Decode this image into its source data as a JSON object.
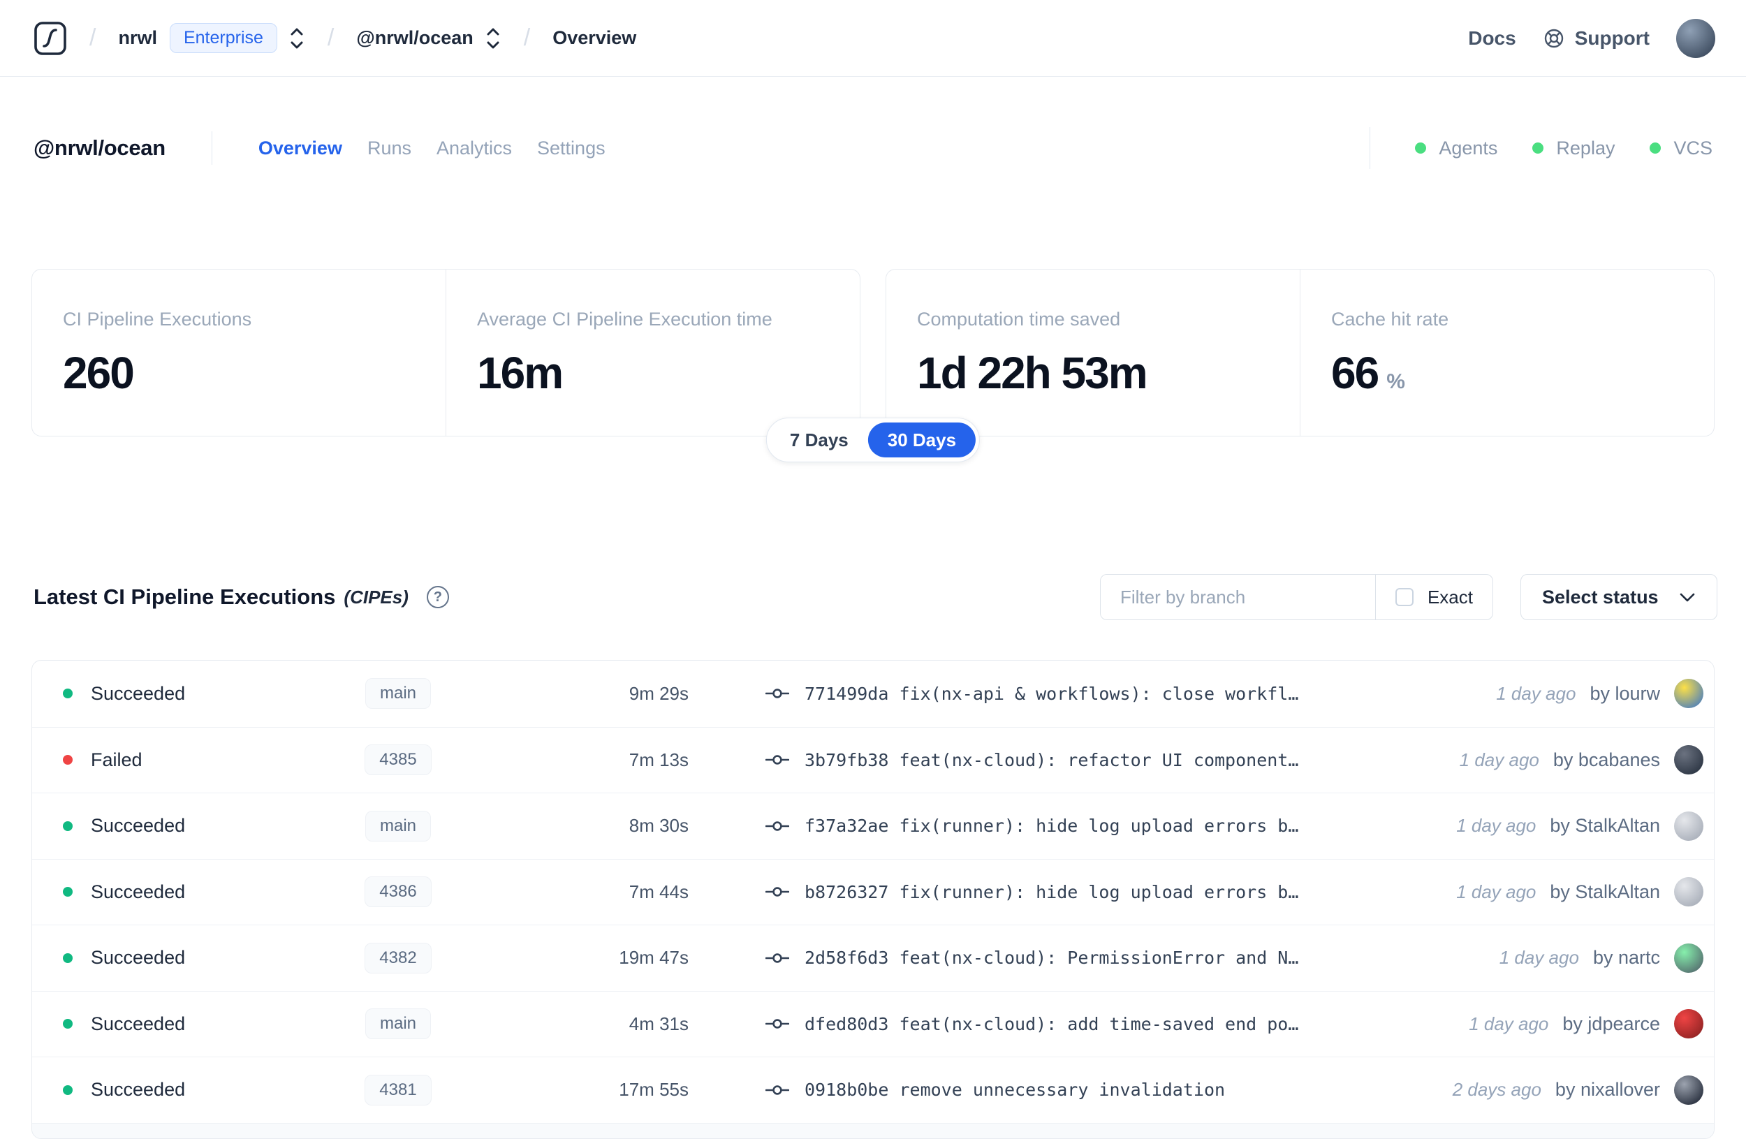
{
  "nav": {
    "separator": "/",
    "breadcrumb": {
      "org": "nrwl",
      "plan_badge": "Enterprise",
      "workspace": "@nrwl/ocean",
      "page": "Overview"
    },
    "links": {
      "docs": "Docs",
      "support": "Support"
    },
    "avatar_colors": [
      "#8fa0b5",
      "#2c3a4d"
    ]
  },
  "workspace_header": {
    "title": "@nrwl/ocean",
    "tabs": [
      {
        "label": "Overview",
        "active": true
      },
      {
        "label": "Runs",
        "active": false
      },
      {
        "label": "Analytics",
        "active": false
      },
      {
        "label": "Settings",
        "active": false
      }
    ],
    "status_indicators": [
      {
        "label": "Agents",
        "color": "#4ade80"
      },
      {
        "label": "Replay",
        "color": "#4ade80"
      },
      {
        "label": "VCS",
        "color": "#4ade80"
      }
    ]
  },
  "stats": {
    "cards": [
      {
        "label": "CI Pipeline Executions",
        "value": "260",
        "unit": ""
      },
      {
        "label": "Average CI Pipeline Execution time",
        "value": "16m",
        "unit": ""
      },
      {
        "label": "Computation time saved",
        "value": "1d 22h 53m",
        "unit": ""
      },
      {
        "label": "Cache hit rate",
        "value": "66",
        "unit": "%"
      }
    ],
    "range_toggle": {
      "options": [
        "7 Days",
        "30 Days"
      ],
      "selected": "30 Days"
    }
  },
  "cipes": {
    "title": "Latest CI Pipeline Executions",
    "title_suffix": "(CIPEs)",
    "help_icon": "?",
    "filter": {
      "placeholder": "Filter by branch",
      "exact_label": "Exact",
      "exact_checked": false
    },
    "status_select": {
      "label": "Select status"
    },
    "rows": [
      {
        "status": "Succeeded",
        "status_color": "#10b981",
        "branch": "main",
        "duration": "9m 29s",
        "commit": "771499da fix(nx-api & workflows): close workfl…",
        "time_ago": "1 day ago",
        "author": "by lourw",
        "avatar_colors": [
          "#fde047",
          "#2f6fd0"
        ]
      },
      {
        "status": "Failed",
        "status_color": "#ef4444",
        "branch": "4385",
        "duration": "7m 13s",
        "commit": "3b79fb38 feat(nx-cloud): refactor UI component…",
        "time_ago": "1 day ago",
        "author": "by bcabanes",
        "avatar_colors": [
          "#6b7280",
          "#1f2937"
        ]
      },
      {
        "status": "Succeeded",
        "status_color": "#10b981",
        "branch": "main",
        "duration": "8m 30s",
        "commit": "f37a32ae fix(runner): hide log upload errors b…",
        "time_ago": "1 day ago",
        "author": "by StalkAltan",
        "avatar_colors": [
          "#e5e7eb",
          "#9ca3af"
        ]
      },
      {
        "status": "Succeeded",
        "status_color": "#10b981",
        "branch": "4386",
        "duration": "7m 44s",
        "commit": "b8726327 fix(runner): hide log upload errors b…",
        "time_ago": "1 day ago",
        "author": "by StalkAltan",
        "avatar_colors": [
          "#e5e7eb",
          "#9ca3af"
        ]
      },
      {
        "status": "Succeeded",
        "status_color": "#10b981",
        "branch": "4382",
        "duration": "19m 47s",
        "commit": "2d58f6d3 feat(nx-cloud): PermissionError and N…",
        "time_ago": "1 day ago",
        "author": "by nartc",
        "avatar_colors": [
          "#86efac",
          "#4b5563"
        ]
      },
      {
        "status": "Succeeded",
        "status_color": "#10b981",
        "branch": "main",
        "duration": "4m 31s",
        "commit": "dfed80d3 feat(nx-cloud): add time-saved end po…",
        "time_ago": "1 day ago",
        "author": "by jdpearce",
        "avatar_colors": [
          "#ef4444",
          "#7f1d1d"
        ]
      },
      {
        "status": "Succeeded",
        "status_color": "#10b981",
        "branch": "4381",
        "duration": "17m 55s",
        "commit": "0918b0be remove unnecessary invalidation",
        "time_ago": "2 days ago",
        "author": "by nixallover",
        "avatar_colors": [
          "#9ca3af",
          "#111827"
        ]
      }
    ]
  },
  "colors": {
    "accent_blue": "#2563eb",
    "success_green": "#10b981",
    "failed_red": "#ef4444",
    "indicator_green": "#4ade80"
  }
}
